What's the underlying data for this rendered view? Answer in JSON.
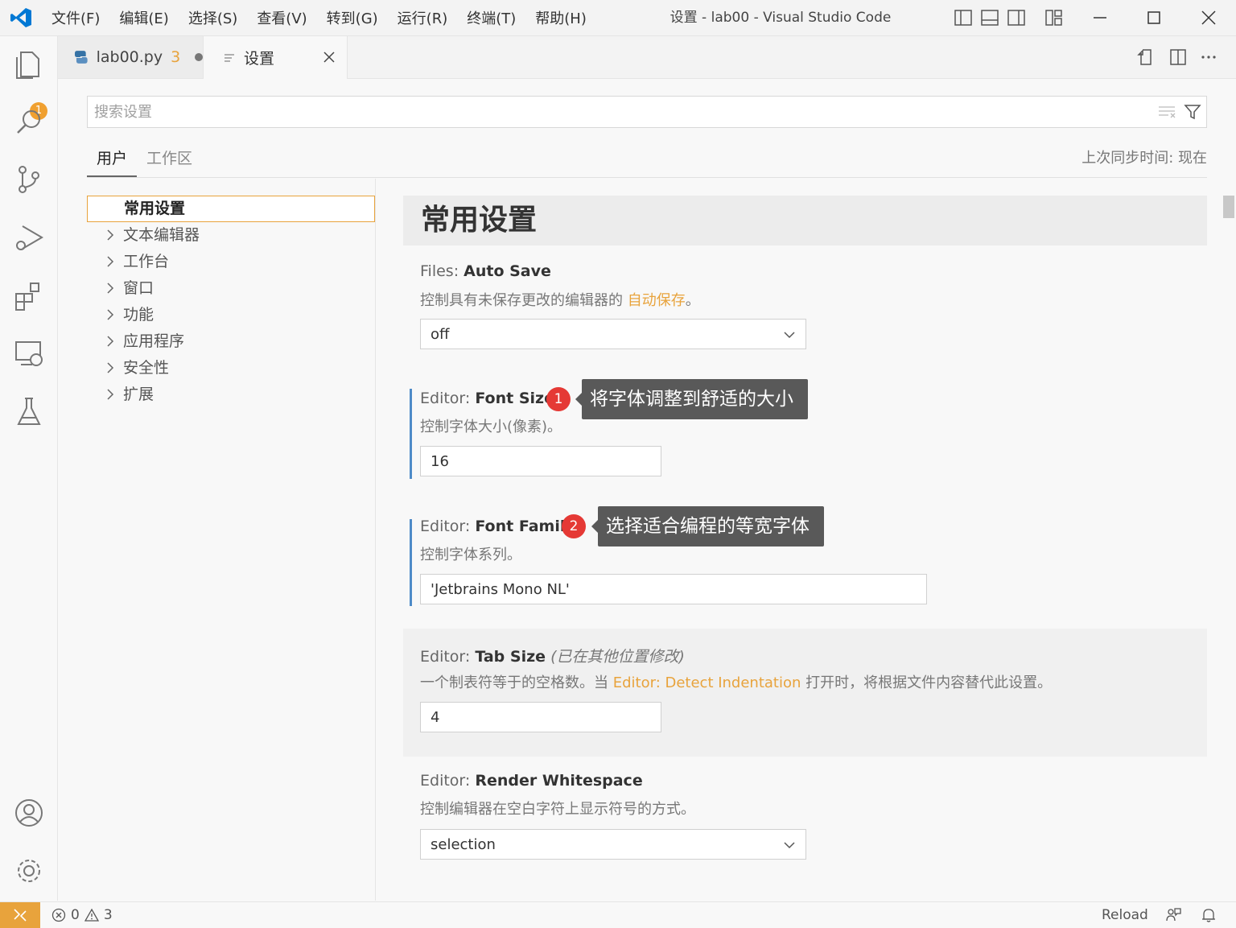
{
  "window": {
    "title": "设置 - lab00 - Visual Studio Code",
    "menu": [
      "文件(F)",
      "编辑(E)",
      "选择(S)",
      "查看(V)",
      "转到(G)",
      "运行(R)",
      "终端(T)",
      "帮助(H)"
    ]
  },
  "activity": {
    "explorer_badge": "1"
  },
  "tabs": [
    {
      "label": "lab00.py",
      "problems": "3"
    },
    {
      "label": "设置"
    }
  ],
  "search": {
    "placeholder": "搜索设置"
  },
  "scopes": {
    "user": "用户",
    "workspace": "工作区",
    "sync": "上次同步时间: 现在"
  },
  "toc": [
    "常用设置",
    "文本编辑器",
    "工作台",
    "窗口",
    "功能",
    "应用程序",
    "安全性",
    "扩展"
  ],
  "content": {
    "heading": "常用设置",
    "auto_save": {
      "category": "Files: ",
      "name": "Auto Save",
      "desc_before": "控制具有未保存更改的编辑器的 ",
      "desc_link": "自动保存",
      "desc_after": "。",
      "value": "off"
    },
    "font_size": {
      "category": "Editor: ",
      "name": "Font Size",
      "desc": "控制字体大小(像素)。",
      "value": "16",
      "callout_num": "1",
      "callout_text": "将字体调整到舒适的大小"
    },
    "font_family": {
      "category": "Editor: ",
      "name": "Font Family",
      "desc": "控制字体系列。",
      "value": "'Jetbrains Mono NL'",
      "callout_num": "2",
      "callout_text": "选择适合编程的等宽字体"
    },
    "tab_size": {
      "category": "Editor: ",
      "name": "Tab Size",
      "modified": "(已在其他位置修改)",
      "desc_before": "一个制表符等于的空格数。当 ",
      "desc_link": "Editor: Detect Indentation",
      "desc_after": " 打开时，将根据文件内容替代此设置。",
      "value": "4"
    },
    "render_whitespace": {
      "category": "Editor: ",
      "name": "Render Whitespace",
      "desc": "控制编辑器在空白字符上显示符号的方式。",
      "value": "selection"
    }
  },
  "status": {
    "errors": "0",
    "warnings": "3",
    "reload": "Reload"
  },
  "colors": {
    "accent": "#e8a33c",
    "vscode_blue": "#0078d4",
    "callout_bg": "#595959",
    "callout_num": "#e53935"
  }
}
